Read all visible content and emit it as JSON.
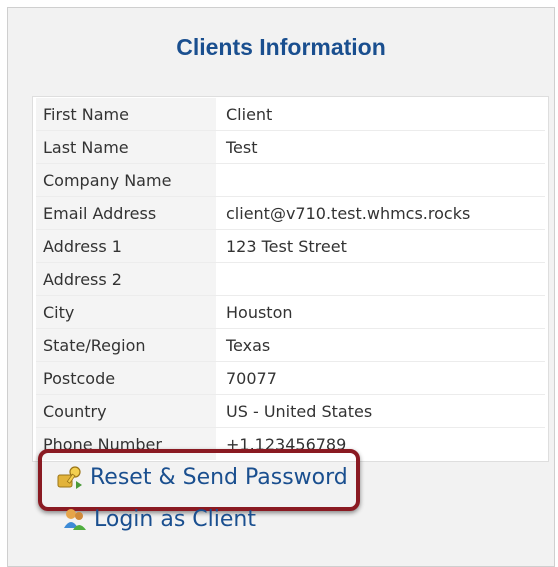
{
  "panel": {
    "title": "Clients Information"
  },
  "rows": [
    {
      "label": "First Name",
      "value": "Client"
    },
    {
      "label": "Last Name",
      "value": "Test"
    },
    {
      "label": "Company Name",
      "value": ""
    },
    {
      "label": "Email Address",
      "value": "client@v710.test.whmcs.rocks"
    },
    {
      "label": "Address 1",
      "value": "123 Test Street"
    },
    {
      "label": "Address 2",
      "value": ""
    },
    {
      "label": "City",
      "value": "Houston"
    },
    {
      "label": "State/Region",
      "value": "Texas"
    },
    {
      "label": "Postcode",
      "value": "70077"
    },
    {
      "label": "Country",
      "value": "US - United States"
    },
    {
      "label": "Phone Number",
      "value": "+1.123456789"
    }
  ],
  "actions": {
    "reset_password": {
      "label": "Reset & Send Password",
      "icon": "key-icon"
    },
    "login_as_client": {
      "label": "Login as Client",
      "icon": "users-icon"
    }
  },
  "colors": {
    "title": "#1a4f8f",
    "link": "#1a4f8f",
    "highlight": "#8a1a22",
    "panel_bg": "#f2f2f2"
  }
}
